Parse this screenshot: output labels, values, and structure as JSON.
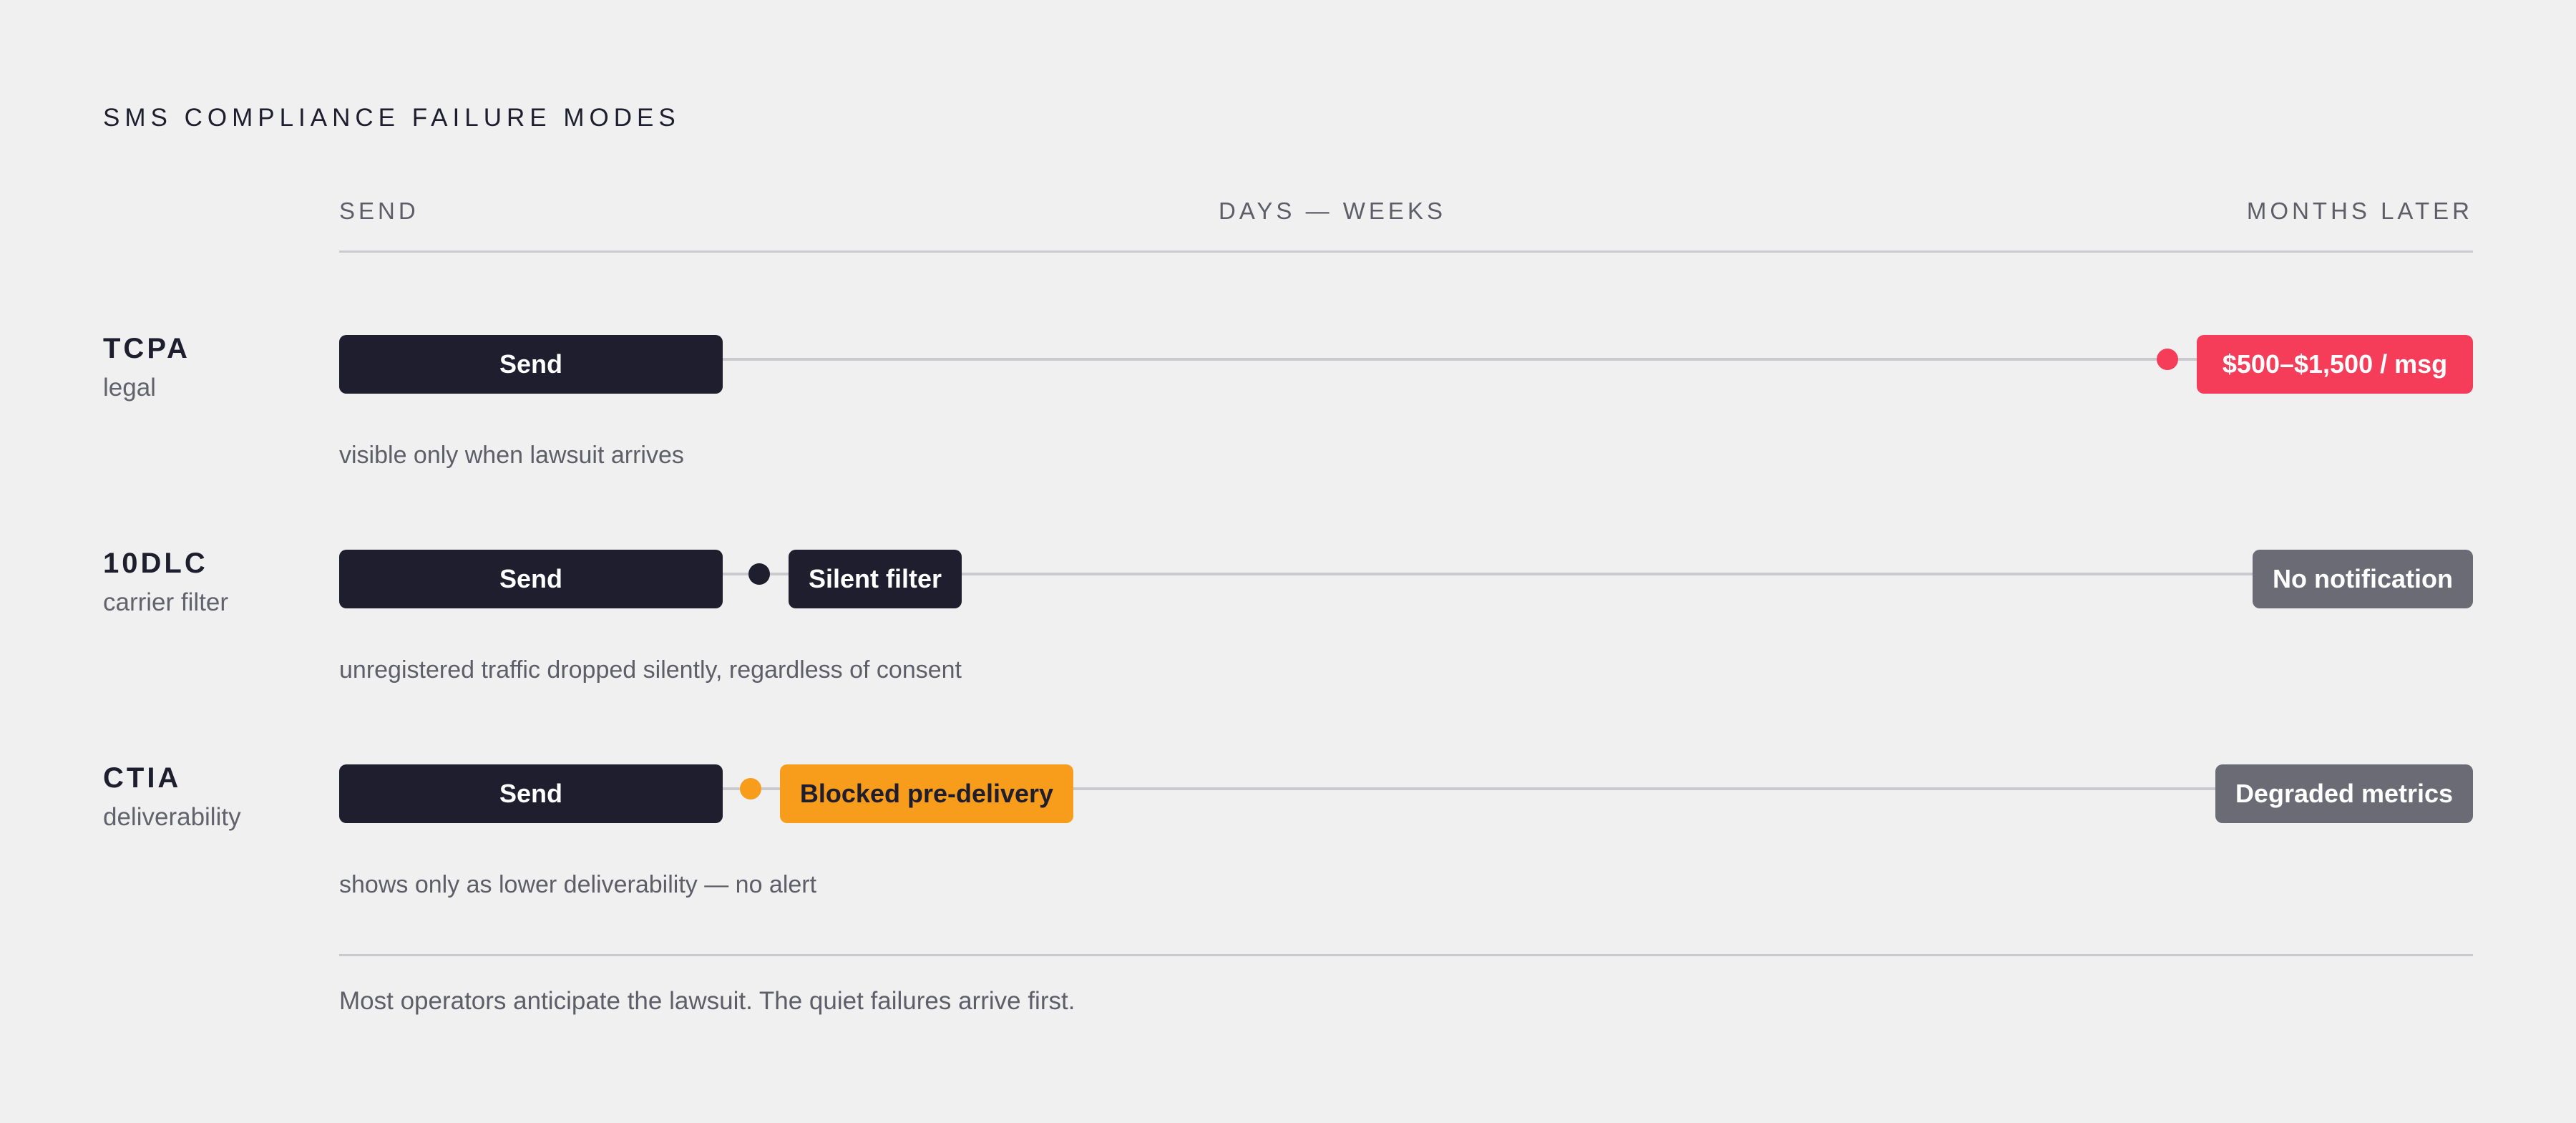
{
  "title": "SMS COMPLIANCE FAILURE MODES",
  "axis": {
    "start": "SEND",
    "middle": "DAYS — WEEKS",
    "end": "MONTHS LATER"
  },
  "rows": [
    {
      "name": "TCPA",
      "subtitle": "legal",
      "send_label": "Send",
      "end_label": "$500–$1,500 / msg",
      "note": "visible only when lawsuit arrives",
      "colors": {
        "marker": "#f53d5a",
        "end": "#f53d5a"
      }
    },
    {
      "name": "10DLC",
      "subtitle": "carrier filter",
      "send_label": "Send",
      "mid_label": "Silent filter",
      "end_label": "No notification",
      "note": "unregistered traffic dropped silently, regardless of consent",
      "colors": {
        "marker": "#1e1e2e",
        "end": "#6b6b75"
      }
    },
    {
      "name": "CTIA",
      "subtitle": "deliverability",
      "send_label": "Send",
      "mid_label": "Blocked pre-delivery",
      "end_label": "Degraded metrics",
      "note": "shows only as lower deliverability — no alert",
      "colors": {
        "marker": "#f89c1c",
        "end": "#6b6b75"
      }
    }
  ],
  "footer": "Most operators anticipate the lawsuit. The quiet failures arrive first.",
  "colors": {
    "background": "#f0f0f0",
    "ink": "#1e1e2e",
    "red": "#f53d5a",
    "orange": "#f89c1c",
    "gray": "#6b6b75",
    "rule": "#c9c9ce"
  }
}
